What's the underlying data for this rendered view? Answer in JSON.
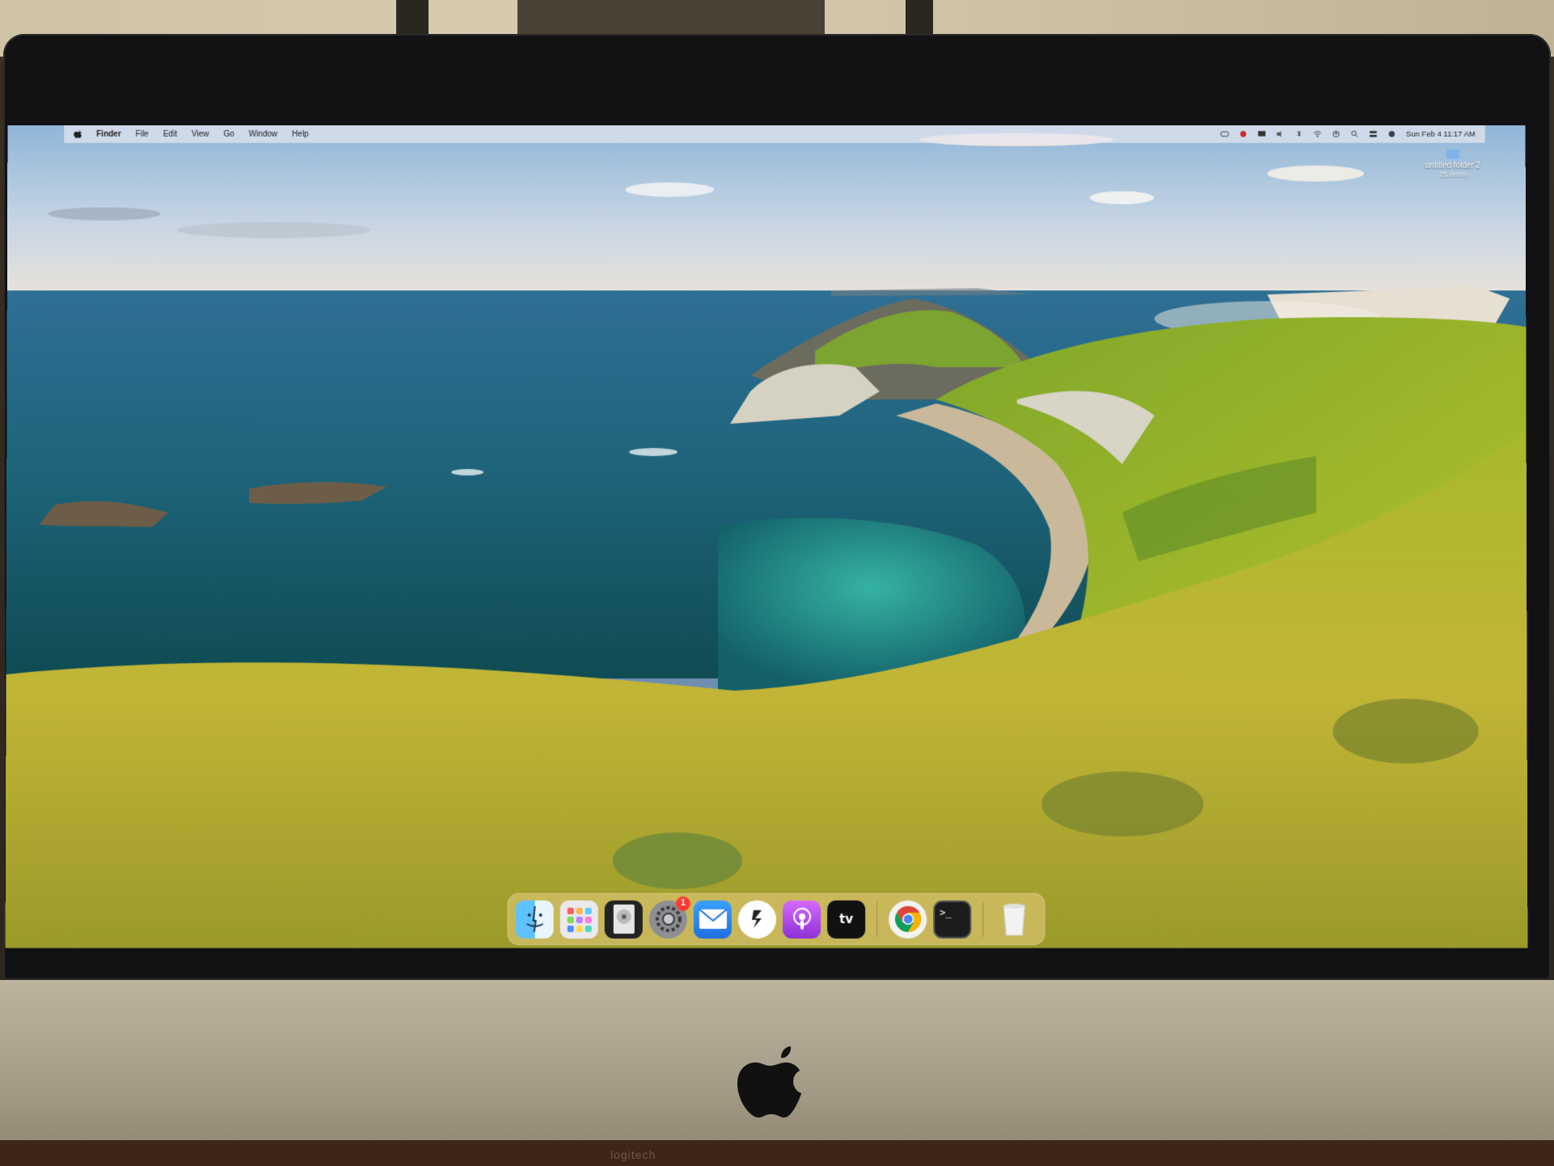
{
  "menubar": {
    "apple_icon": "apple-icon",
    "app_name": "Finder",
    "items": [
      "File",
      "Edit",
      "View",
      "Go",
      "Window",
      "Help"
    ],
    "status_icons": [
      "screen-record-icon",
      "focus-icon",
      "notification-icon",
      "mute-icon",
      "bluetooth-icon",
      "wifi-icon",
      "account-icon",
      "search-icon",
      "control-center-icon",
      "siri-icon"
    ],
    "clock": "Sun Feb 4  11:17 AM"
  },
  "desktop": {
    "folder_name": "untitled folder 2",
    "folder_count": "25 items"
  },
  "dock": {
    "items": [
      {
        "name": "finder",
        "icon": "finder-icon"
      },
      {
        "name": "launchpad",
        "icon": "launchpad-icon"
      },
      {
        "name": "disk-utility",
        "icon": "disk-utility-icon"
      },
      {
        "name": "system-preferences",
        "icon": "gear-icon",
        "badge": "1"
      },
      {
        "name": "mail",
        "icon": "mail-icon"
      },
      {
        "name": "shortcuts",
        "icon": "shortcuts-icon"
      },
      {
        "name": "podcasts",
        "icon": "podcasts-icon"
      },
      {
        "name": "apple-tv",
        "icon": "apple-tv-icon",
        "label": "tv"
      },
      {
        "name": "chrome",
        "icon": "chrome-icon"
      },
      {
        "name": "terminal",
        "icon": "terminal-icon",
        "label": ">_"
      },
      {
        "name": "trash",
        "icon": "trash-icon"
      }
    ]
  },
  "hardware": {
    "desk_brand": "logitech"
  },
  "colors": {
    "dock_bg": "#ebcd82",
    "menubar_bg": "#e6e6ee",
    "badge": "#ff3b30"
  }
}
